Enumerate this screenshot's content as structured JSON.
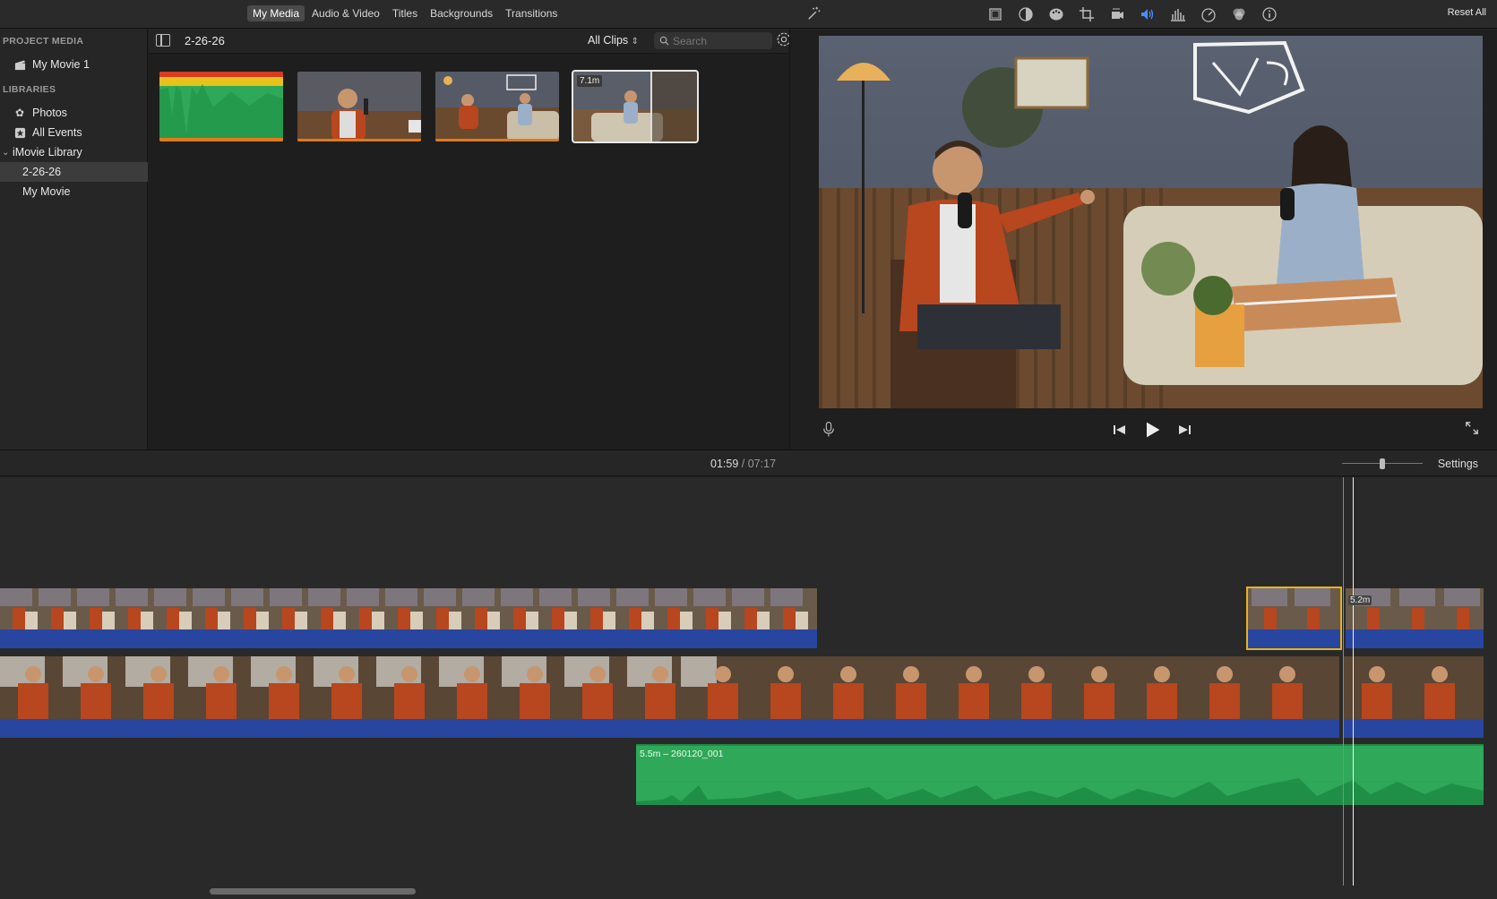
{
  "toolbar": {
    "tabs": [
      {
        "label": "My Media",
        "active": true
      },
      {
        "label": "Audio & Video",
        "active": false
      },
      {
        "label": "Titles",
        "active": false
      },
      {
        "label": "Backgrounds",
        "active": false
      },
      {
        "label": "Transitions",
        "active": false
      }
    ],
    "tool_icons": [
      "crop-fill-icon",
      "color-balance-icon",
      "color-palette-icon",
      "crop-icon",
      "stabilization-icon",
      "volume-icon",
      "equalizer-icon",
      "speed-icon",
      "noise-filter-icon",
      "info-icon"
    ],
    "reset_all_label": "Reset All"
  },
  "sidebar": {
    "project_media_header": "PROJECT MEDIA",
    "project_item": "My Movie 1",
    "libraries_header": "LIBRARIES",
    "items": [
      {
        "label": "Photos",
        "icon": "photos-icon"
      },
      {
        "label": "All Events",
        "icon": "star-icon"
      },
      {
        "label": "iMovie Library",
        "icon": "disclosure-icon"
      },
      {
        "label": "2-26-26",
        "selected": true
      },
      {
        "label": "My Movie"
      }
    ]
  },
  "browser": {
    "title": "2-26-26",
    "filter": "All Clips",
    "search_placeholder": "Search",
    "thumbnails": [
      {
        "name": "audio-clip-thumbnail"
      },
      {
        "name": "man-closeup-thumbnail"
      },
      {
        "name": "two-shot-thumbnail"
      },
      {
        "name": "selected-clip-thumbnail",
        "badge": "7.1m",
        "selected": true
      }
    ]
  },
  "timeline": {
    "current_time": "01:59",
    "separator": "/",
    "total_time": "07:17",
    "settings_label": "Settings",
    "audio_clip_label": "5.5m – 260120_001",
    "playhead_tag": "5.2m"
  },
  "colors": {
    "audio_track": "#2846a0",
    "audio_clip": "#2fa85a",
    "selection": "#e6b31e",
    "accent_blue": "#4a8cff"
  }
}
